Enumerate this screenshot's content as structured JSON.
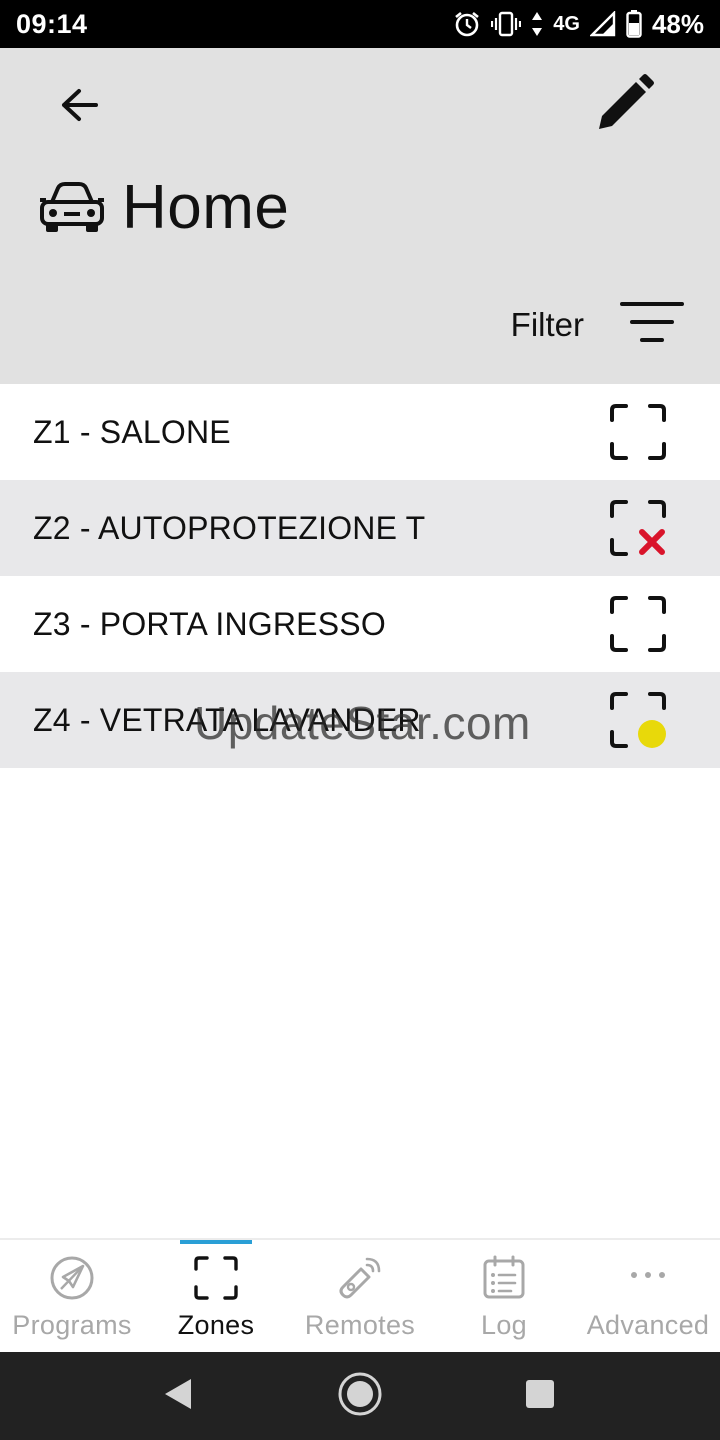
{
  "status_bar": {
    "time": "09:14",
    "network": "4G",
    "battery": "48%"
  },
  "header": {
    "title": "Home",
    "filter_label": "Filter",
    "icons": {
      "back": "arrow-left-icon",
      "edit": "pencil-icon",
      "title": "car-icon",
      "filter": "filter-lines-icon"
    }
  },
  "zones": [
    {
      "label": "Z1 - SALONE",
      "status": "normal"
    },
    {
      "label": "Z2 - AUTOPROTEZIONE T",
      "status": "fault"
    },
    {
      "label": "Z3 - PORTA INGRESSO",
      "status": "normal"
    },
    {
      "label": "Z4 - VETRATA LAVANDER",
      "status": "warning"
    }
  ],
  "watermark": "UpdateStar.com",
  "bottom_nav": {
    "items": [
      {
        "label": "Programs",
        "icon": "compass-icon",
        "active": false
      },
      {
        "label": "Zones",
        "icon": "zone-frame-icon",
        "active": true
      },
      {
        "label": "Remotes",
        "icon": "remote-tag-icon",
        "active": false
      },
      {
        "label": "Log",
        "icon": "log-list-icon",
        "active": false
      },
      {
        "label": "Advanced",
        "icon": "more-dots-icon",
        "active": false
      }
    ],
    "active_color": "#2a9fd6"
  },
  "colors": {
    "header_bg": "#e1e1e1",
    "row_alt_bg": "#e8e8ea",
    "fault": "#d9142b",
    "warning": "#e8d90a"
  }
}
